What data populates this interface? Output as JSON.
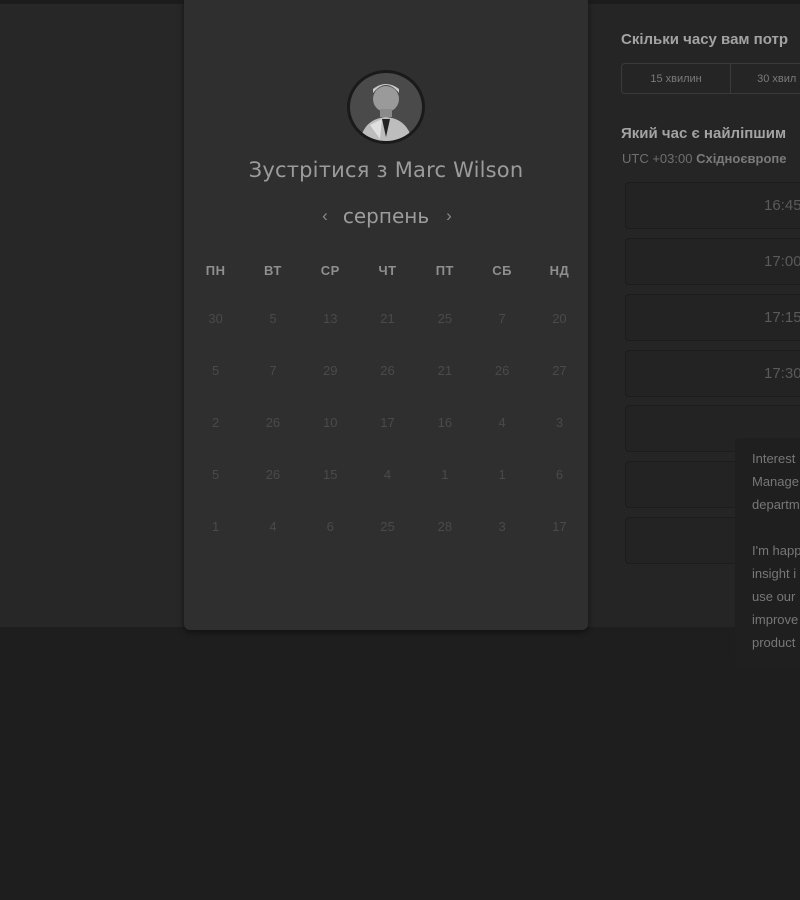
{
  "colors": {
    "background": "#1e1e1e",
    "card": "#2f2f2f",
    "panel": "#252525"
  },
  "header": {
    "title_prefix": "Зустрітися з",
    "host_name": "Marc Wilson",
    "avatar_icon": "user-photo"
  },
  "calendar": {
    "month": "серпень",
    "prev_icon": "chevron-left-icon",
    "next_icon": "chevron-right-icon",
    "weekdays": [
      "ПН",
      "ВТ",
      "СР",
      "ЧТ",
      "ПТ",
      "СБ",
      "НД"
    ],
    "weeks": [
      [
        "30",
        "5",
        "13",
        "21",
        "25",
        "7",
        "20"
      ],
      [
        "5",
        "7",
        "29",
        "26",
        "21",
        "26",
        "27"
      ],
      [
        "2",
        "26",
        "10",
        "17",
        "16",
        "4",
        "3"
      ],
      [
        "5",
        "26",
        "15",
        "4",
        "1",
        "1",
        "6"
      ],
      [
        "1",
        "4",
        "6",
        "25",
        "28",
        "3",
        "17"
      ]
    ]
  },
  "duration": {
    "question": "Скільки часу вам потр",
    "options": [
      "15 хвилин",
      "30 хвил"
    ]
  },
  "time": {
    "question": "Який час є найліпшим",
    "timezone_offset": "UTC +03:00",
    "timezone_name": "Східноєвропе",
    "slots": [
      "16:45",
      "17:00",
      "17:15",
      "17:30",
      "",
      "",
      ""
    ]
  },
  "tooltip": {
    "lines_para1": [
      "Interest",
      "Manage",
      "departm"
    ],
    "lines_para2": [
      "I'm happ",
      "insight i",
      "use our",
      "improve",
      "product"
    ]
  }
}
